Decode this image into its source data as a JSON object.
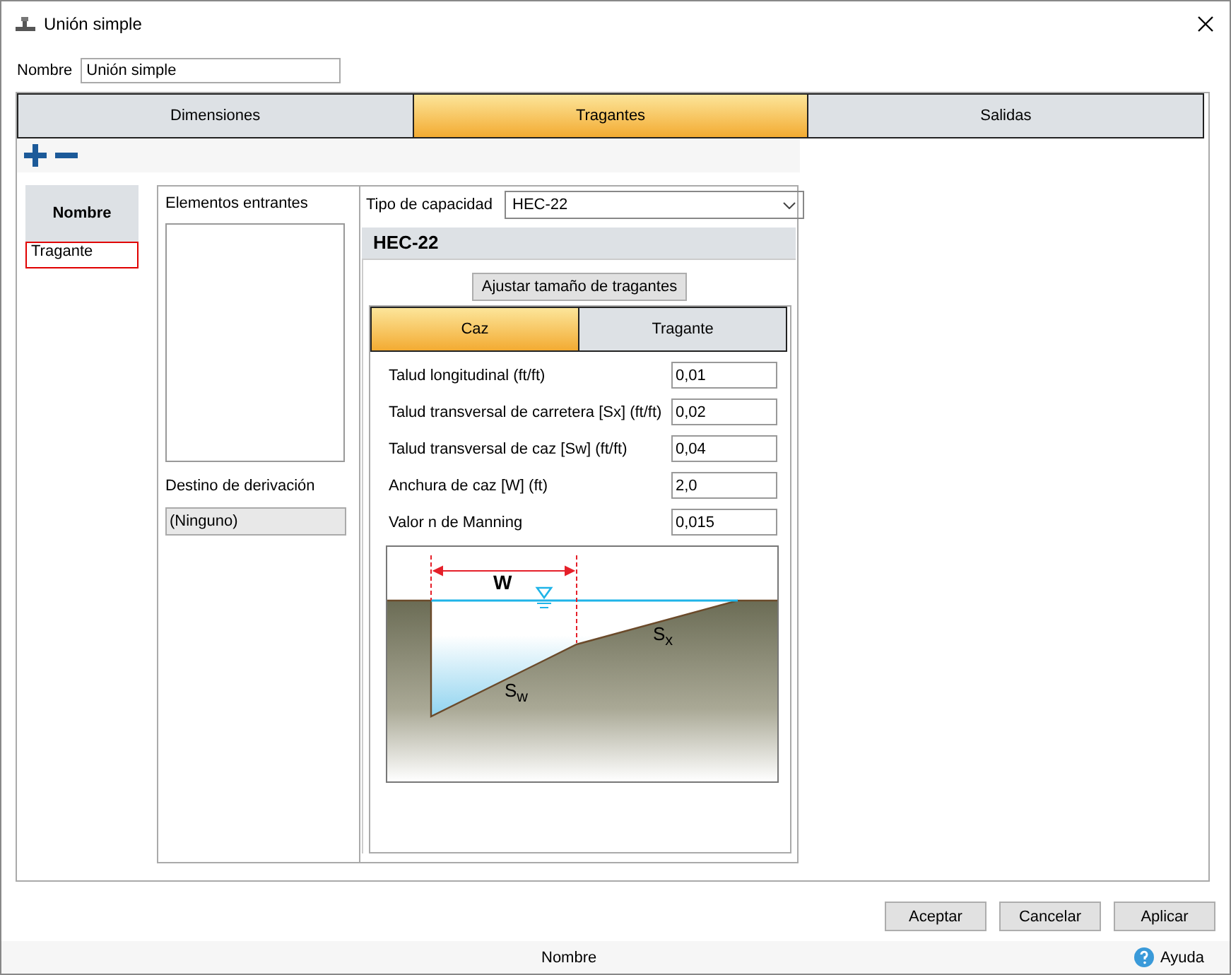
{
  "window": {
    "title": "Unión simple"
  },
  "name_field": {
    "label": "Nombre",
    "value": "Unión simple"
  },
  "tabs": [
    {
      "label": "Dimensiones",
      "selected": false
    },
    {
      "label": "Tragantes",
      "selected": true
    },
    {
      "label": "Salidas",
      "selected": false
    }
  ],
  "inlet_list": {
    "header": "Nombre",
    "items": [
      {
        "label": "Tragante",
        "selected": true
      }
    ]
  },
  "incoming": {
    "label": "Elementos entrantes"
  },
  "bypass": {
    "label": "Destino de derivación",
    "value": "(Ninguno)"
  },
  "capacity": {
    "label": "Tipo de capacidad",
    "value": "HEC-22"
  },
  "group": {
    "title": "HEC-22",
    "size_button": "Ajustar tamaño de tragantes",
    "tabs": [
      {
        "label": "Caz",
        "selected": true
      },
      {
        "label": "Tragante",
        "selected": false
      }
    ],
    "fields": [
      {
        "label": "Talud longitudinal (ft/ft)",
        "value": "0,01"
      },
      {
        "label": "Talud transversal de carretera [Sx] (ft/ft)",
        "value": "0,02"
      },
      {
        "label": "Talud transversal de caz [Sw] (ft/ft)",
        "value": "0,04"
      },
      {
        "label": "Anchura de caz [W] (ft)",
        "value": "2,0"
      },
      {
        "label": "Valor n de Manning",
        "value": "0,015"
      }
    ],
    "diagram": {
      "width_label": "W",
      "sx_label": "S$_{x}$",
      "sw_label": "S$_{w}$"
    }
  },
  "buttons": [
    "Aceptar",
    "Cancelar",
    "Aplicar"
  ],
  "status_bar": {
    "text": "Nombre",
    "help": "Ayuda"
  }
}
